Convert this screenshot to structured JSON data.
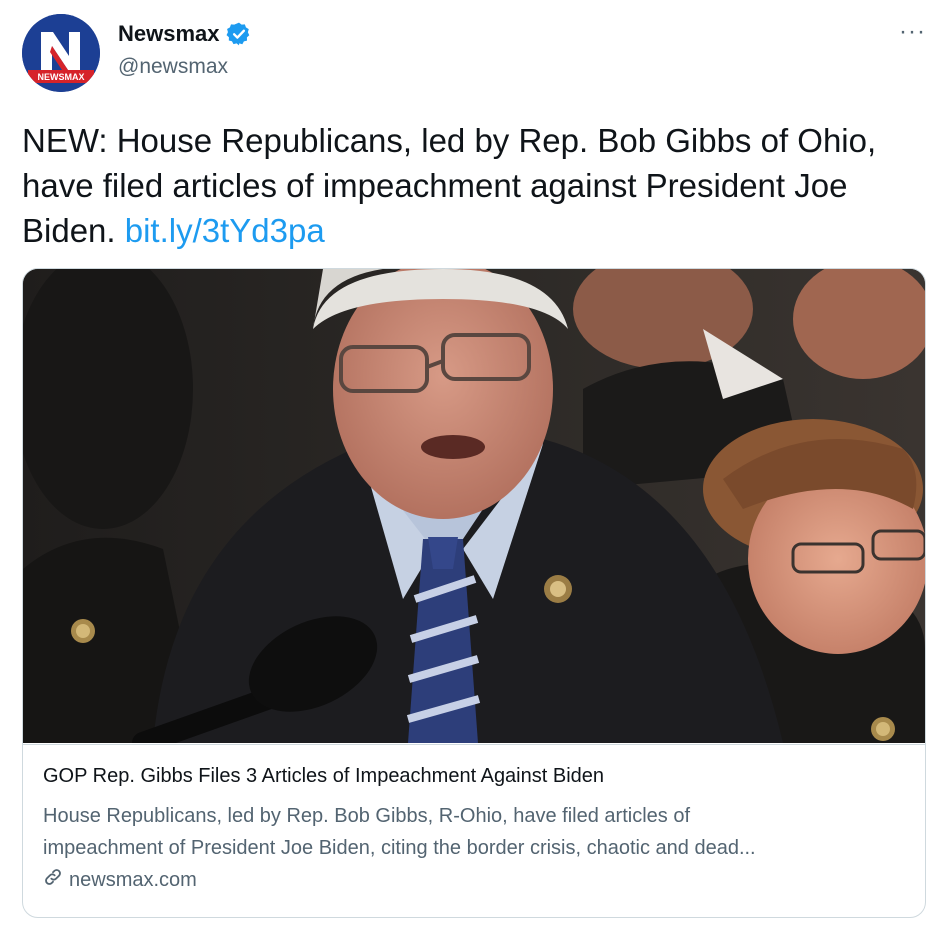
{
  "account": {
    "display_name": "Newsmax",
    "handle": "@newsmax",
    "avatar_icon": "newsmax-logo",
    "avatar_logo_letter": "N",
    "avatar_logo_text": "NEWSMAX",
    "verified": true,
    "verified_color": "#1d9bf0"
  },
  "tweet": {
    "text": "NEW: House Republicans, led by Rep. Bob Gibbs of Ohio, have filed articles of impeachment against President Joe Biden.",
    "link_text": "bit.ly/3tYd3pa",
    "more_label": "···"
  },
  "card": {
    "title": "GOP Rep. Gibbs Files 3 Articles of Impeachment Against Biden",
    "description_line1": "House Republicans, led by Rep. Bob Gibbs, R-Ohio, have filed articles of",
    "description_line2": "impeachment of President Joe Biden, citing the border crisis, chaotic and dead...",
    "domain": "newsmax.com",
    "image_subject": "photo-of-rep-bob-gibbs-speaking-at-microphone"
  },
  "colors": {
    "text_primary": "#0f1419",
    "text_secondary": "#536471",
    "link": "#1d9bf0",
    "border": "#cfd9de"
  }
}
